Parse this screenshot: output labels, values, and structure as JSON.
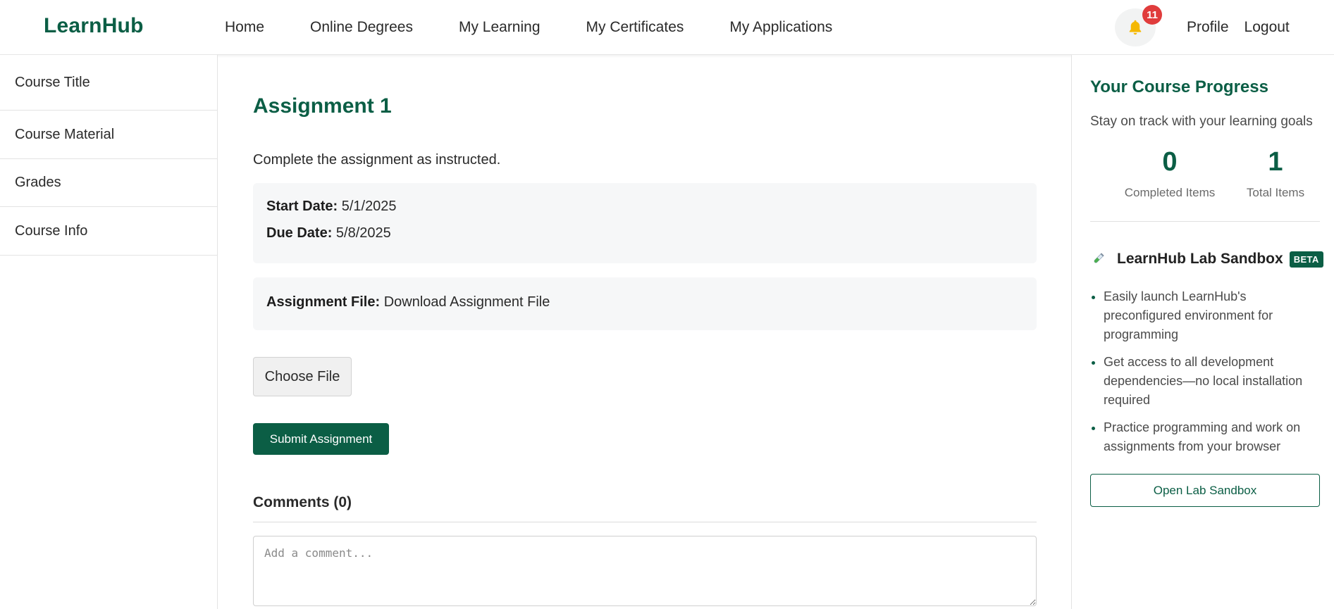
{
  "brand": {
    "name": "LearnHub",
    "color": "#0b5e45"
  },
  "nav": {
    "items": [
      "Home",
      "Online Degrees",
      "My Learning",
      "My Certificates",
      "My Applications"
    ],
    "notifications": {
      "icon": "bell-icon",
      "count": "11"
    },
    "user_links": [
      "Profile",
      "Logout"
    ]
  },
  "sidebar": {
    "items": [
      {
        "label": "Course Title"
      },
      {
        "label": "Course Material"
      },
      {
        "label": "Grades"
      },
      {
        "label": "Course Info"
      }
    ]
  },
  "assignment": {
    "title": "Assignment 1",
    "description": "Complete the assignment as instructed.",
    "start_date_label": "Start Date:",
    "start_date": "5/1/2025",
    "due_date_label": "Due Date:",
    "due_date": "5/8/2025",
    "file_label": "Assignment File:",
    "file_link": "Download Assignment File",
    "choose_file_label": "Choose File",
    "submit_label": "Submit Assignment"
  },
  "comments": {
    "title": "Comments (0)",
    "placeholder": "Add a comment..."
  },
  "progress": {
    "title": "Your Course Progress",
    "subtitle": "Stay on track with your learning goals",
    "completed_value": "0",
    "completed_label": "Completed Items",
    "total_value": "1",
    "total_label": "Total Items"
  },
  "lab": {
    "icon": "test-tube-icon",
    "name": "LearnHub Lab Sandbox",
    "badge": "BETA",
    "features": [
      "Easily launch LearnHub's preconfigured environment for programming",
      "Get access to all development dependencies—no local installation required",
      "Practice programming and work on assignments from your browser"
    ],
    "button_label": "Open Lab Sandbox"
  },
  "colors": {
    "accent": "#0b5e45",
    "badge": "#e03c3c",
    "bell": "#f5b800"
  }
}
